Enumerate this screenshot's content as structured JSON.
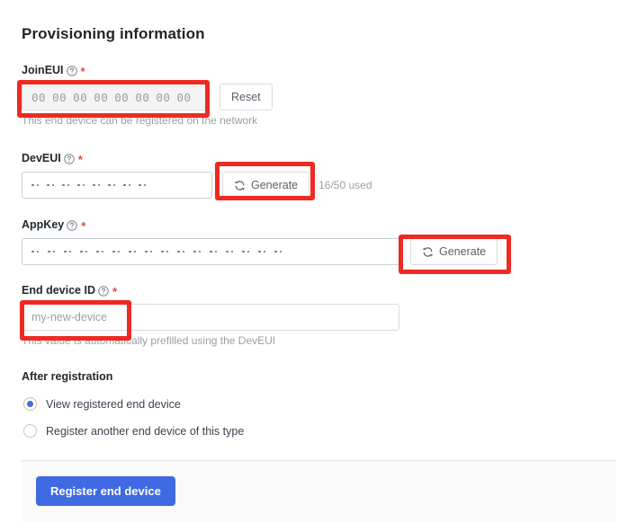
{
  "section": {
    "title": "Provisioning information"
  },
  "fields": {
    "join_eui": {
      "label": "JoinEUI",
      "required_marker": "*",
      "help_icon": "question-circle-icon",
      "value_pairs": [
        "00",
        "00",
        "00",
        "00",
        "00",
        "00",
        "00",
        "00"
      ],
      "reset_button": "Reset",
      "hint": "This end device can be registered on the network"
    },
    "dev_eui": {
      "label": "DevEUI",
      "required_marker": "*",
      "help_icon": "question-circle-icon",
      "mask_groups": 8,
      "generate_button": "Generate",
      "generate_icon": "refresh-icon",
      "usage": "16/50 used"
    },
    "app_key": {
      "label": "AppKey",
      "required_marker": "*",
      "help_icon": "question-circle-icon",
      "mask_groups": 16,
      "generate_button": "Generate",
      "generate_icon": "refresh-icon"
    },
    "end_device_id": {
      "label": "End device ID",
      "required_marker": "*",
      "help_icon": "question-circle-icon",
      "placeholder": "my-new-device",
      "value": "",
      "hint": "This value is automatically prefilled using the DevEUI"
    }
  },
  "after_registration": {
    "title": "After registration",
    "options": [
      {
        "label": "View registered end device",
        "selected": true
      },
      {
        "label": "Register another end device of this type",
        "selected": false
      }
    ]
  },
  "footer": {
    "submit_button": "Register end device"
  },
  "annotations": {
    "color": "#ee2a22",
    "boxes": [
      {
        "name": "join-eui-input-highlight"
      },
      {
        "name": "dev-eui-generate-highlight"
      },
      {
        "name": "app-key-generate-highlight"
      },
      {
        "name": "end-device-id-input-highlight"
      }
    ]
  },
  "colors": {
    "primary_button": "#3f6ae1",
    "required_asterisk": "#e8453c",
    "radio_selected": "#3b6fe0",
    "annotation_red": "#ee2a22"
  }
}
